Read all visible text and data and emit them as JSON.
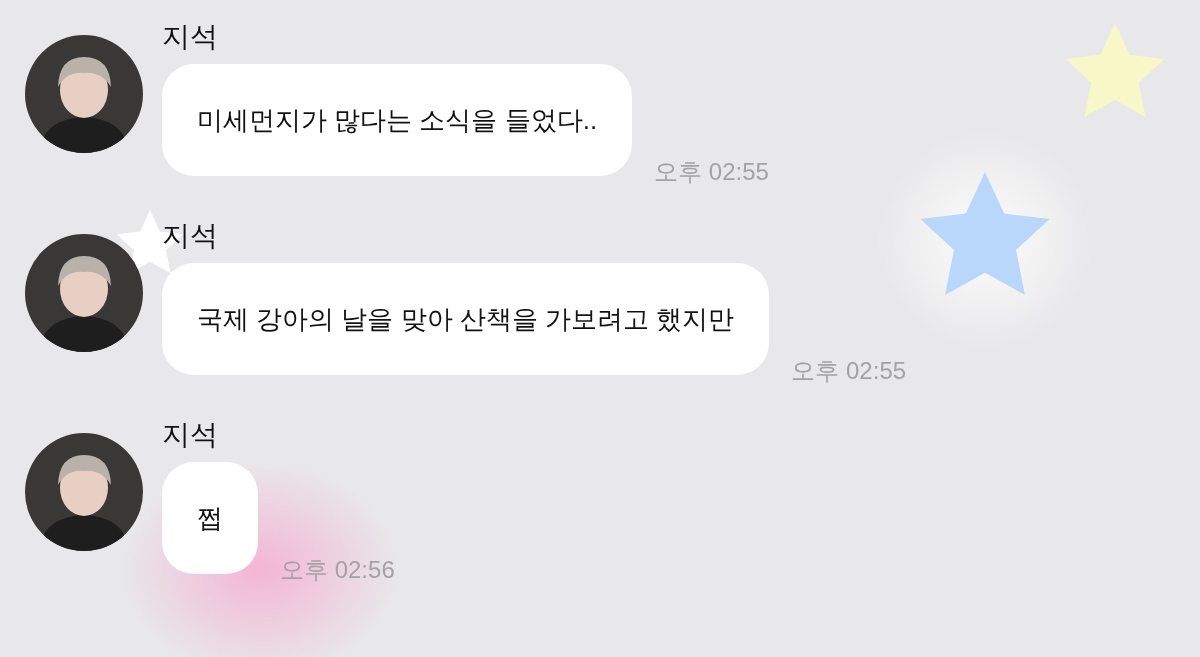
{
  "messages": [
    {
      "sender": "지석",
      "text": "미세먼지가 많다는 소식을 들었다..",
      "time": "오후 02:55"
    },
    {
      "sender": "지석",
      "text": "국제 강아의 날을 맞아 산책을 가보려고 했지만",
      "time": "오후 02:55"
    },
    {
      "sender": "지석",
      "text": "쩝",
      "time": "오후 02:56"
    }
  ]
}
